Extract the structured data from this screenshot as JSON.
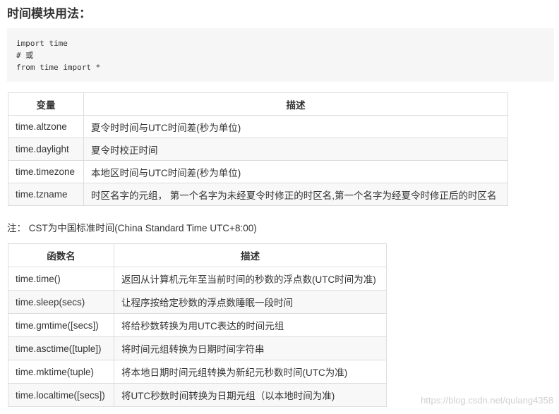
{
  "title": "时间模块用法：",
  "code": {
    "lines": [
      "import time",
      "# 或",
      "from time import *"
    ]
  },
  "variables_table": {
    "headers": [
      "变量",
      "描述"
    ],
    "rows": [
      [
        "time.altzone",
        "夏令时时间与UTC时间差(秒为单位)"
      ],
      [
        "time.daylight",
        "夏令时校正时间"
      ],
      [
        "time.timezone",
        "本地区时间与UTC时间差(秒为单位)"
      ],
      [
        "time.tzname",
        "时区名字的元组， 第一个名字为未经夏令时修正的时区名,第一个名字为经夏令时修正后的时区名"
      ]
    ]
  },
  "note": "注： CST为中国标准时间(China Standard Time UTC+8:00)",
  "functions_table": {
    "headers": [
      "函数名",
      "描述"
    ],
    "rows": [
      [
        "time.time()",
        "返回从计算机元年至当前时间的秒数的浮点数(UTC时间为准)"
      ],
      [
        "time.sleep(secs)",
        "让程序按给定秒数的浮点数睡眠一段时间"
      ],
      [
        "time.gmtime([secs])",
        "将给秒数转换为用UTC表达的时间元组"
      ],
      [
        "time.asctime([tuple])",
        "将时间元组转换为日期时间字符串"
      ],
      [
        "time.mktime(tuple)",
        "将本地日期时间元组转换为新纪元秒数时间(UTC为准)"
      ],
      [
        "time.localtime([secs])",
        "将UTC秒数时间转换为日期元组（以本地时间为准)"
      ]
    ]
  },
  "watermark": "https://blog.csdn.net/qulang4358"
}
